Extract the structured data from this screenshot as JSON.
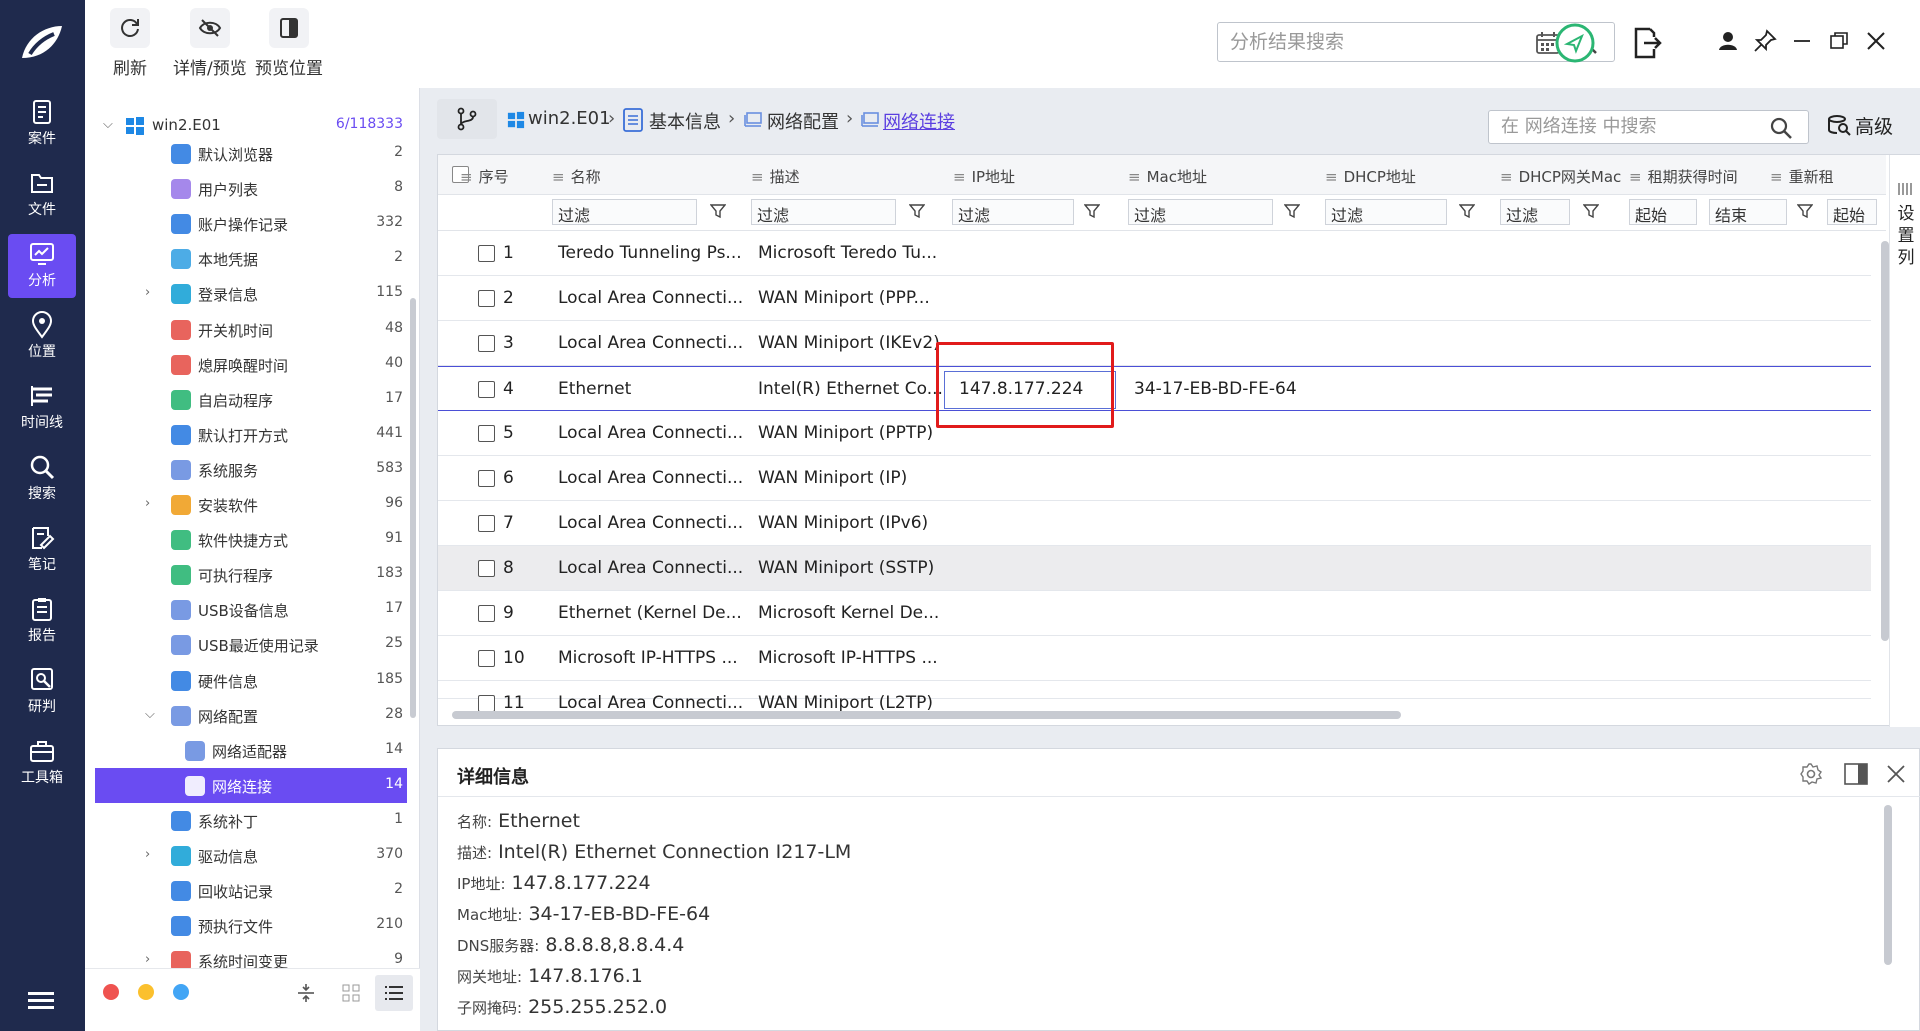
{
  "toolbar": {
    "refresh": "刷新",
    "detail_preview": "详情/预览",
    "preview_position": "预览位置",
    "search_placeholder": "分析结果搜索"
  },
  "nav": [
    {
      "label": "案件",
      "icon": "case-icon"
    },
    {
      "label": "文件",
      "icon": "folder-icon"
    },
    {
      "label": "分析",
      "icon": "analysis-icon",
      "active": true
    },
    {
      "label": "位置",
      "icon": "location-icon"
    },
    {
      "label": "时间线",
      "icon": "timeline-icon"
    },
    {
      "label": "搜索",
      "icon": "search-icon"
    },
    {
      "label": "笔记",
      "icon": "note-icon"
    },
    {
      "label": "报告",
      "icon": "report-icon"
    },
    {
      "label": "研判",
      "icon": "judge-icon"
    },
    {
      "label": "工具箱",
      "icon": "toolbox-icon"
    }
  ],
  "tree": {
    "root": {
      "label": "win2.E01",
      "count": "6/118333"
    },
    "items": [
      {
        "label": "默认浏览器",
        "count": "2",
        "color": "#2f7de1"
      },
      {
        "label": "用户列表",
        "count": "8",
        "color": "#9b7be9"
      },
      {
        "label": "账户操作记录",
        "count": "332",
        "color": "#2f7de1"
      },
      {
        "label": "本地凭据",
        "count": "2",
        "color": "#3aa3e3"
      },
      {
        "label": "登录信息",
        "count": "115",
        "color": "#1ba3d6",
        "expandable": true
      },
      {
        "label": "开关机时间",
        "count": "48",
        "color": "#e5534b"
      },
      {
        "label": "熄屏唤醒时间",
        "count": "40",
        "color": "#e5534b"
      },
      {
        "label": "自启动程序",
        "count": "17",
        "color": "#2bb673"
      },
      {
        "label": "默认打开方式",
        "count": "441",
        "color": "#2f7de1"
      },
      {
        "label": "系统服务",
        "count": "583",
        "color": "#6a8fe0"
      },
      {
        "label": "安装软件",
        "count": "96",
        "color": "#f0a020",
        "expandable": true
      },
      {
        "label": "软件快捷方式",
        "count": "91",
        "color": "#2bb673"
      },
      {
        "label": "可执行程序",
        "count": "183",
        "color": "#2bb673"
      },
      {
        "label": "USB设备信息",
        "count": "17",
        "color": "#6a8fe0"
      },
      {
        "label": "USB最近使用记录",
        "count": "25",
        "color": "#6a8fe0"
      },
      {
        "label": "硬件信息",
        "count": "185",
        "color": "#2f7de1"
      },
      {
        "label": "网络配置",
        "count": "28",
        "color": "#6a8fe0",
        "expanded": true
      },
      {
        "label": "网络适配器",
        "count": "14",
        "color": "#6a8fe0",
        "child": true
      },
      {
        "label": "网络连接",
        "count": "14",
        "color": "#ffffff",
        "child": true,
        "selected": true
      },
      {
        "label": "系统补丁",
        "count": "1",
        "color": "#2f7de1"
      },
      {
        "label": "驱动信息",
        "count": "370",
        "color": "#1ba3d6",
        "expandable": true
      },
      {
        "label": "回收站记录",
        "count": "2",
        "color": "#2f7de1"
      },
      {
        "label": "预执行文件",
        "count": "210",
        "color": "#2f7de1"
      },
      {
        "label": "系统时间变更",
        "count": "9",
        "color": "#e5534b",
        "expandable": true
      }
    ]
  },
  "breadcrumb": {
    "items": [
      "win2.E01",
      "基本信息",
      "网络配置",
      "网络连接"
    ],
    "search_placeholder": "在 网络连接 中搜索",
    "advanced": "高级"
  },
  "grid": {
    "columns": [
      "序号",
      "名称",
      "描述",
      "IP地址",
      "Mac地址",
      "DHCP地址",
      "DHCP网关Mac",
      "租期获得时间",
      "重新租"
    ],
    "filter": "过滤",
    "filter_start": "起始",
    "filter_end": "结束",
    "settings_label": [
      "设",
      "置",
      "列"
    ],
    "rows": [
      {
        "no": "1",
        "name": "Teredo Tunneling Ps...",
        "desc": "Microsoft Teredo Tu...",
        "ip": "",
        "mac": ""
      },
      {
        "no": "2",
        "name": "Local Area Connecti...",
        "desc": "WAN Miniport (PPP...",
        "ip": "",
        "mac": ""
      },
      {
        "no": "3",
        "name": "Local Area Connecti...",
        "desc": "WAN Miniport (IKEv2)",
        "ip": "",
        "mac": ""
      },
      {
        "no": "4",
        "name": "Ethernet",
        "desc": "Intel(R) Ethernet Co...",
        "ip": "147.8.177.224",
        "mac": "34-17-EB-BD-FE-64"
      },
      {
        "no": "5",
        "name": "Local Area Connecti...",
        "desc": "WAN Miniport (PPTP)",
        "ip": "",
        "mac": ""
      },
      {
        "no": "6",
        "name": "Local Area Connecti...",
        "desc": "WAN Miniport (IP)",
        "ip": "",
        "mac": ""
      },
      {
        "no": "7",
        "name": "Local Area Connecti...",
        "desc": "WAN Miniport (IPv6)",
        "ip": "",
        "mac": ""
      },
      {
        "no": "8",
        "name": "Local Area Connecti...",
        "desc": "WAN Miniport (SSTP)",
        "ip": "",
        "mac": ""
      },
      {
        "no": "9",
        "name": "Ethernet (Kernel De...",
        "desc": "Microsoft Kernel De...",
        "ip": "",
        "mac": ""
      },
      {
        "no": "10",
        "name": "Microsoft IP-HTTPS ...",
        "desc": "Microsoft IP-HTTPS ...",
        "ip": "",
        "mac": ""
      },
      {
        "no": "11",
        "name": "Local Area Connecti...",
        "desc": "WAN Miniport (L2TP)",
        "ip": "",
        "mac": ""
      }
    ]
  },
  "detail": {
    "title": "详细信息",
    "fields": [
      {
        "key": "名称:",
        "value": "Ethernet"
      },
      {
        "key": "描述:",
        "value": "Intel(R) Ethernet Connection I217-LM"
      },
      {
        "key": "IP地址:",
        "value": "147.8.177.224"
      },
      {
        "key": "Mac地址:",
        "value": "34-17-EB-BD-FE-64"
      },
      {
        "key": "DNS服务器:",
        "value": "8.8.8.8,8.8.4.4"
      },
      {
        "key": "网关地址:",
        "value": "147.8.176.1"
      },
      {
        "key": "子网掩码:",
        "value": "255.255.252.0"
      }
    ]
  },
  "colors": {
    "accent": "#6a4cf2",
    "nav_bg": "#1f2a4d",
    "highlight": "#e11b1b"
  }
}
